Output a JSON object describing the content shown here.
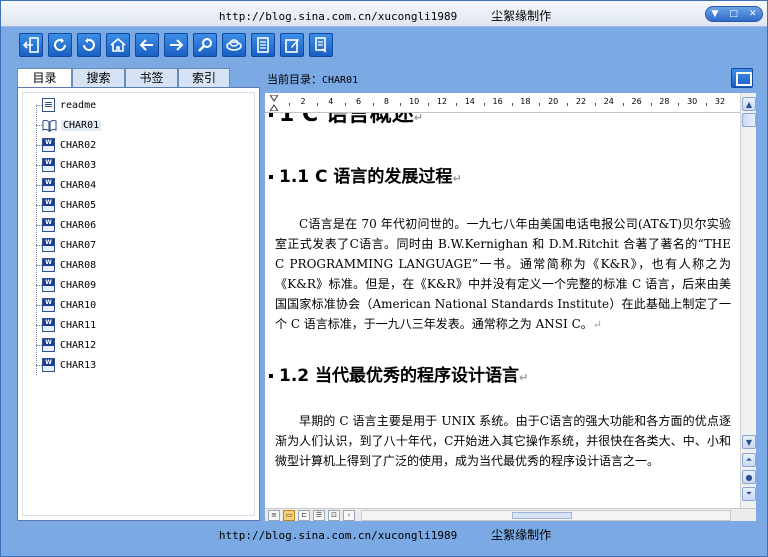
{
  "window": {
    "title_url": "http://blog.sina.com.cn/xucongli1989",
    "title_brand": "尘絮缘制作",
    "controls": [
      "▼",
      "□",
      "✕"
    ]
  },
  "toolbar": {
    "buttons": [
      {
        "name": "exit-icon"
      },
      {
        "name": "refresh-icon"
      },
      {
        "name": "reload-icon"
      },
      {
        "name": "home-icon"
      },
      {
        "name": "back-arrow-icon"
      },
      {
        "name": "forward-arrow-icon"
      },
      {
        "name": "search-icon"
      },
      {
        "name": "link-icon"
      },
      {
        "name": "notes-icon"
      },
      {
        "name": "edit-icon"
      },
      {
        "name": "bookmark-icon"
      }
    ]
  },
  "sidebar": {
    "tabs": [
      "目录",
      "搜索",
      "书签",
      "索引"
    ],
    "active_tab": "目录",
    "items": [
      {
        "label": "readme",
        "icon": "text-doc-icon"
      },
      {
        "label": "CHAR01",
        "icon": "open-book-icon",
        "selected": true
      },
      {
        "label": "CHAR02",
        "icon": "word-doc-icon"
      },
      {
        "label": "CHAR03",
        "icon": "word-doc-icon"
      },
      {
        "label": "CHAR04",
        "icon": "word-doc-icon"
      },
      {
        "label": "CHAR05",
        "icon": "word-doc-icon"
      },
      {
        "label": "CHAR06",
        "icon": "word-doc-icon"
      },
      {
        "label": "CHAR07",
        "icon": "word-doc-icon"
      },
      {
        "label": "CHAR08",
        "icon": "word-doc-icon"
      },
      {
        "label": "CHAR09",
        "icon": "word-doc-icon"
      },
      {
        "label": "CHAR10",
        "icon": "word-doc-icon"
      },
      {
        "label": "CHAR11",
        "icon": "word-doc-icon"
      },
      {
        "label": "CHAR12",
        "icon": "word-doc-icon"
      },
      {
        "label": "CHAR13",
        "icon": "word-doc-icon"
      }
    ]
  },
  "content": {
    "current_dir_label": "当前目录：",
    "current_dir_value": "CHAR01",
    "ruler_ticks": [
      "2",
      "4",
      "6",
      "8",
      "10",
      "12",
      "14",
      "16",
      "18",
      "20",
      "22",
      "24",
      "26",
      "28",
      "30",
      "32"
    ],
    "heading1": "1 C 语言概述",
    "heading2_1": "1.1  C 语言的发展过程",
    "para1": "C语言是在 70 年代初问世的。一九七八年由美国电话电报公司(AT&T)贝尔实验室正式发表了C语言。同时由 B.W.Kernighan 和 D.M.Ritchit 合著了著名的“THE C PROGRAMMING LANGUAGE”一书。通常简称为《K&R》，也有人称之为《K&R》标准。但是，在《K&R》中并没有定义一个完整的标准 C 语言，后来由美国国家标准协会（American National Standards Institute）在此基础上制定了一个 C 语言标准，于一九八三年发表。通常称之为 ANSI C。",
    "heading2_2": "1.2  当代最优秀的程序设计语言",
    "para2": "早期的 C 语言主要是用于 UNIX 系统。由于C语言的强大功能和各方面的优点逐渐为人们认识，到了八十年代，C开始进入其它操作系统，并很快在各类大、中、小和微型计算机上得到了广泛的使用，成为当代最优秀的程序设计语言之一。",
    "para_mark": "↵"
  },
  "viewbar": {
    "buttons": [
      "≡",
      "▭",
      "⊏",
      "☰",
      "⊡",
      "‹"
    ]
  },
  "statusbar": {
    "url": "http://blog.sina.com.cn/xucongli1989",
    "brand": "尘絮缘制作"
  }
}
